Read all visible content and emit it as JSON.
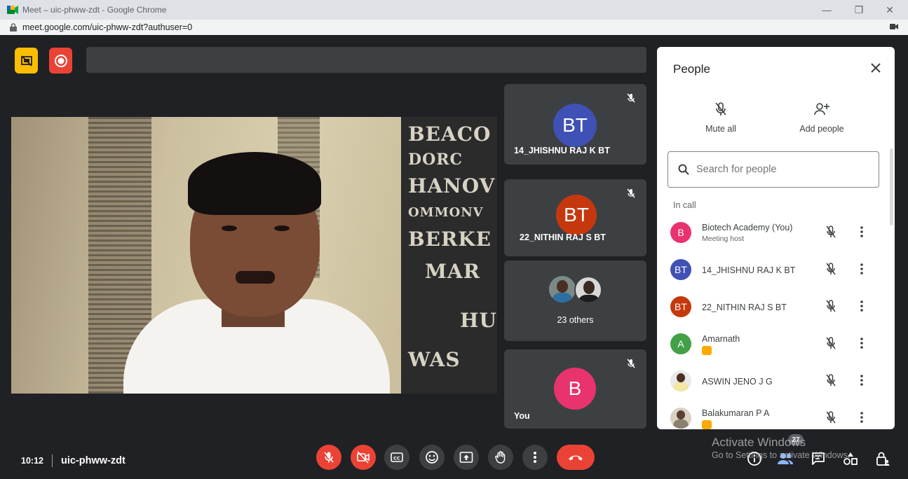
{
  "browser": {
    "window_title": "Meet – uic-phww-zdt - Google Chrome",
    "url": "meet.google.com/uic-phww-zdt?authuser=0",
    "minimize": "—",
    "restore": "❐",
    "close": "✕"
  },
  "colors": {
    "recording_red": "#ea4335",
    "presenting_yellow": "#fbbc04",
    "panel_bg": "#ffffff",
    "meet_bg": "#202124",
    "tile_bg": "#3c4043"
  },
  "main_video": {
    "sign_lines": [
      "BEACO",
      "DORC",
      "HANOV",
      "OMMONV",
      "BERKE",
      "MAR",
      "HU",
      "WAS"
    ]
  },
  "tiles": [
    {
      "initials": "BT",
      "name": "14_JHISHNU RAJ K BT",
      "avatar_color": "#3f51b5"
    },
    {
      "initials": "BT",
      "name": "22_NITHIN RAJ S BT",
      "avatar_color": "#c5380e"
    },
    {
      "others_label": "23 others"
    },
    {
      "initials": "B",
      "name": "You",
      "avatar_color": "#e8336d"
    }
  ],
  "people_panel": {
    "title": "People",
    "mute_all_label": "Mute all",
    "add_people_label": "Add people",
    "search_placeholder": "Search for people",
    "section_label": "In call",
    "participants": [
      {
        "initial": "B",
        "name": "Biotech Academy (You)",
        "subtitle": "Meeting host",
        "avatar_color": "#e8336d"
      },
      {
        "initial": "BT",
        "name": "14_JHISHNU RAJ K BT",
        "avatar_color": "#3f51b5"
      },
      {
        "initial": "BT",
        "name": "22_NITHIN RAJ S BT",
        "avatar_color": "#c5380e"
      },
      {
        "initial": "A",
        "name": "Amarnath",
        "avatar_color": "#43a047",
        "presenting": true
      },
      {
        "name": "ASWIN JENO J G",
        "photo": true
      },
      {
        "name": "Balakumaran P A",
        "photo": true,
        "presenting": true
      }
    ]
  },
  "bottom_bar": {
    "time": "10:12",
    "meeting_code": "uic-phww-zdt",
    "participant_count": "27"
  },
  "watermark": {
    "line1": "Activate Windows",
    "line2": "Go to Settings to activate Windows."
  }
}
